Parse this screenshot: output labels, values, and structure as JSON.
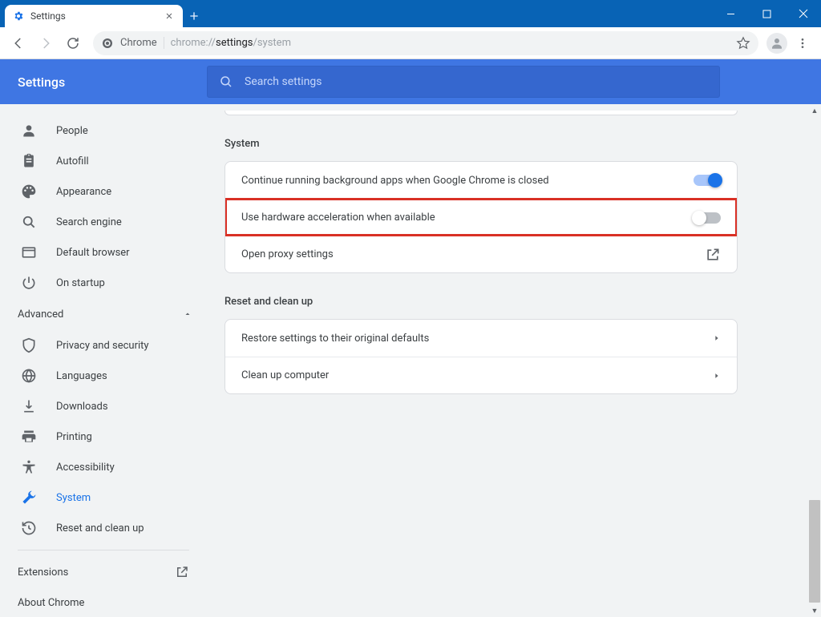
{
  "window": {
    "tab_title": "Settings"
  },
  "toolbar": {
    "url_prefix": "Chrome",
    "url_dim1": "chrome://",
    "url_bold": "settings",
    "url_dim2": "/system"
  },
  "header": {
    "title": "Settings",
    "search_placeholder": "Search settings"
  },
  "sidebar": {
    "items_top": [
      {
        "icon": "people",
        "label": "People"
      },
      {
        "icon": "autofill",
        "label": "Autofill"
      },
      {
        "icon": "appearance",
        "label": "Appearance"
      },
      {
        "icon": "search",
        "label": "Search engine"
      },
      {
        "icon": "defaultbrowser",
        "label": "Default browser"
      },
      {
        "icon": "onstartup",
        "label": "On startup"
      }
    ],
    "advanced_label": "Advanced",
    "items_adv": [
      {
        "icon": "privacy",
        "label": "Privacy and security"
      },
      {
        "icon": "languages",
        "label": "Languages"
      },
      {
        "icon": "downloads",
        "label": "Downloads"
      },
      {
        "icon": "printing",
        "label": "Printing"
      },
      {
        "icon": "accessibility",
        "label": "Accessibility"
      },
      {
        "icon": "system",
        "label": "System",
        "active": true
      },
      {
        "icon": "reset",
        "label": "Reset and clean up"
      }
    ],
    "extensions_label": "Extensions",
    "about_label": "About Chrome"
  },
  "main": {
    "system": {
      "title": "System",
      "rows": [
        {
          "label": "Continue running background apps when Google Chrome is closed",
          "toggle": true
        },
        {
          "label": "Use hardware acceleration when available",
          "toggle": false,
          "highlight": true
        },
        {
          "label": "Open proxy settings",
          "open": true
        }
      ]
    },
    "reset": {
      "title": "Reset and clean up",
      "rows": [
        {
          "label": "Restore settings to their original defaults"
        },
        {
          "label": "Clean up computer"
        }
      ]
    }
  }
}
